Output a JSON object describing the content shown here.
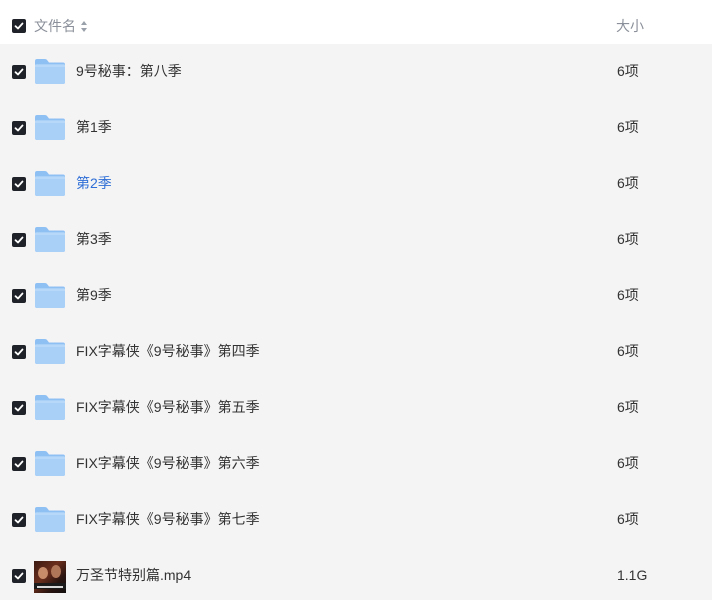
{
  "header": {
    "name_label": "文件名",
    "size_label": "大小"
  },
  "rows": [
    {
      "name": "9号秘事：第八季",
      "size": "6项",
      "type": "folder",
      "selected": true
    },
    {
      "name": "第1季",
      "size": "6项",
      "type": "folder",
      "selected": true
    },
    {
      "name": "第2季",
      "size": "6项",
      "type": "folder",
      "selected": true,
      "hover": true
    },
    {
      "name": "第3季",
      "size": "6项",
      "type": "folder",
      "selected": true
    },
    {
      "name": "第9季",
      "size": "6项",
      "type": "folder",
      "selected": true
    },
    {
      "name": "FIX字幕侠《9号秘事》第四季",
      "size": "6项",
      "type": "folder",
      "selected": true
    },
    {
      "name": "FIX字幕侠《9号秘事》第五季",
      "size": "6项",
      "type": "folder",
      "selected": true
    },
    {
      "name": "FIX字幕侠《9号秘事》第六季",
      "size": "6项",
      "type": "folder",
      "selected": true
    },
    {
      "name": "FIX字幕侠《9号秘事》第七季",
      "size": "6项",
      "type": "folder",
      "selected": true
    },
    {
      "name": "万圣节特别篇.mp4",
      "size": "1.1G",
      "type": "video",
      "selected": true
    }
  ],
  "colors": {
    "checkbox": "#1f2329",
    "row_background": "#f4f4f5",
    "link_active": "#2f6fd6",
    "folder": "#7fb6f0"
  },
  "icons": {
    "folder": "folder-icon",
    "video": "video-thumbnail-icon",
    "check": "checkbox-checked-icon",
    "sort": "sort-arrows-icon"
  }
}
